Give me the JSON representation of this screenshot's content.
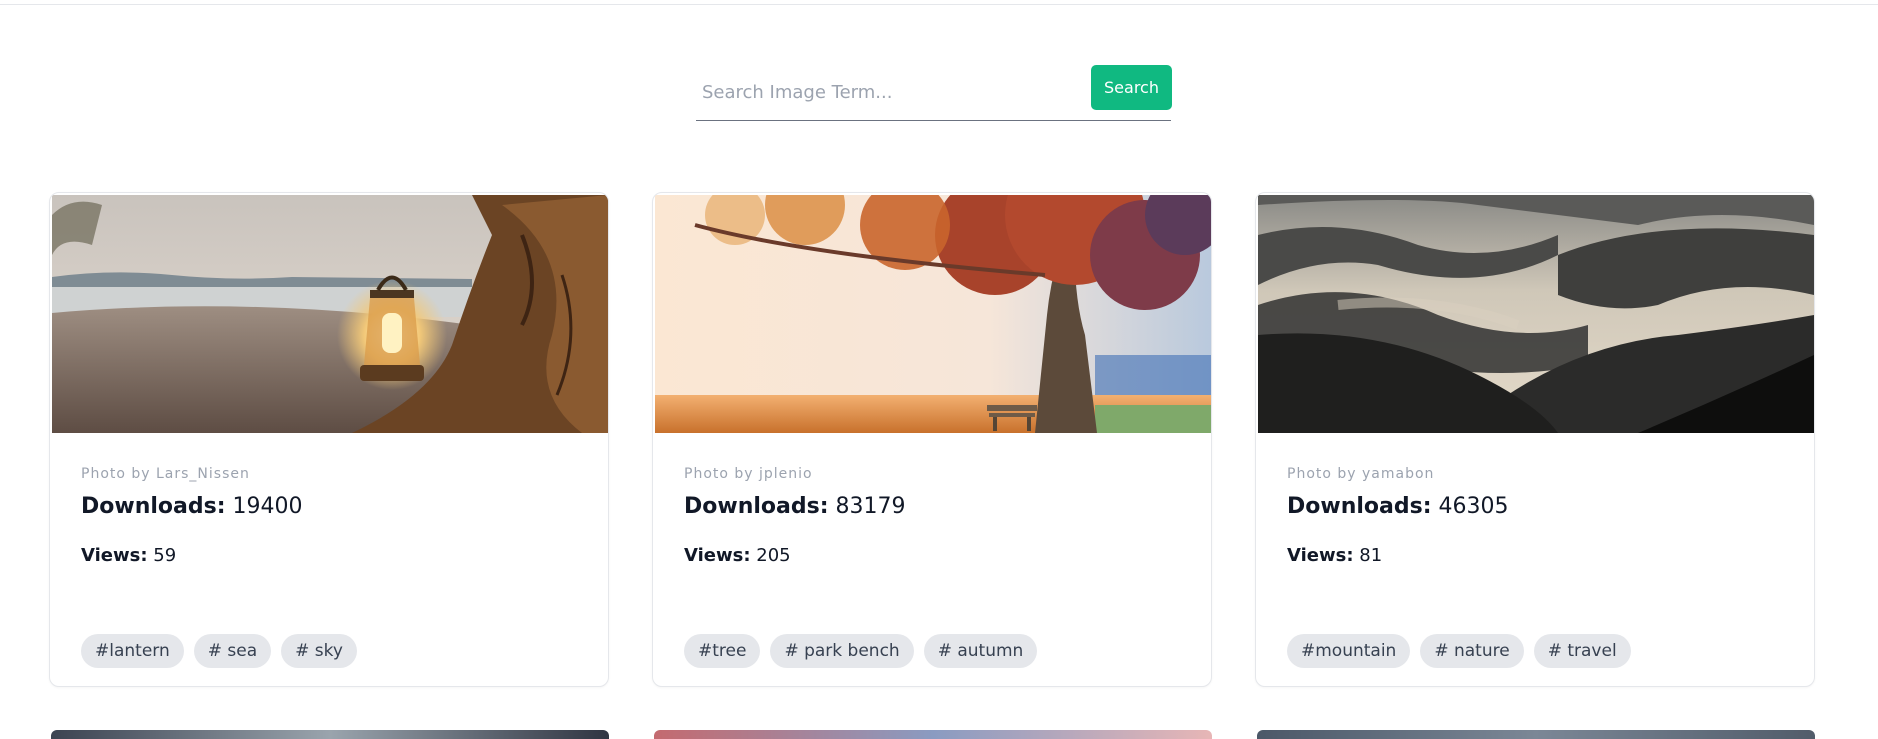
{
  "search": {
    "placeholder": "Search Image Term...",
    "button_label": "Search",
    "accent_color": "#10b981"
  },
  "cards": [
    {
      "author": "Photo by Lars_Nissen",
      "downloads_label": "Downloads:",
      "downloads": "19400",
      "views_label": "Views:",
      "views": "59",
      "tags": [
        "#lantern",
        "# sea",
        "# sky"
      ]
    },
    {
      "author": "Photo by jplenio",
      "downloads_label": "Downloads:",
      "downloads": "83179",
      "views_label": "Views:",
      "views": "205",
      "tags": [
        "#tree",
        "# park bench",
        "# autumn"
      ]
    },
    {
      "author": "Photo by yamabon",
      "downloads_label": "Downloads:",
      "downloads": "46305",
      "views_label": "Views:",
      "views": "81",
      "tags": [
        "#mountain",
        "# nature",
        "# travel"
      ]
    }
  ]
}
